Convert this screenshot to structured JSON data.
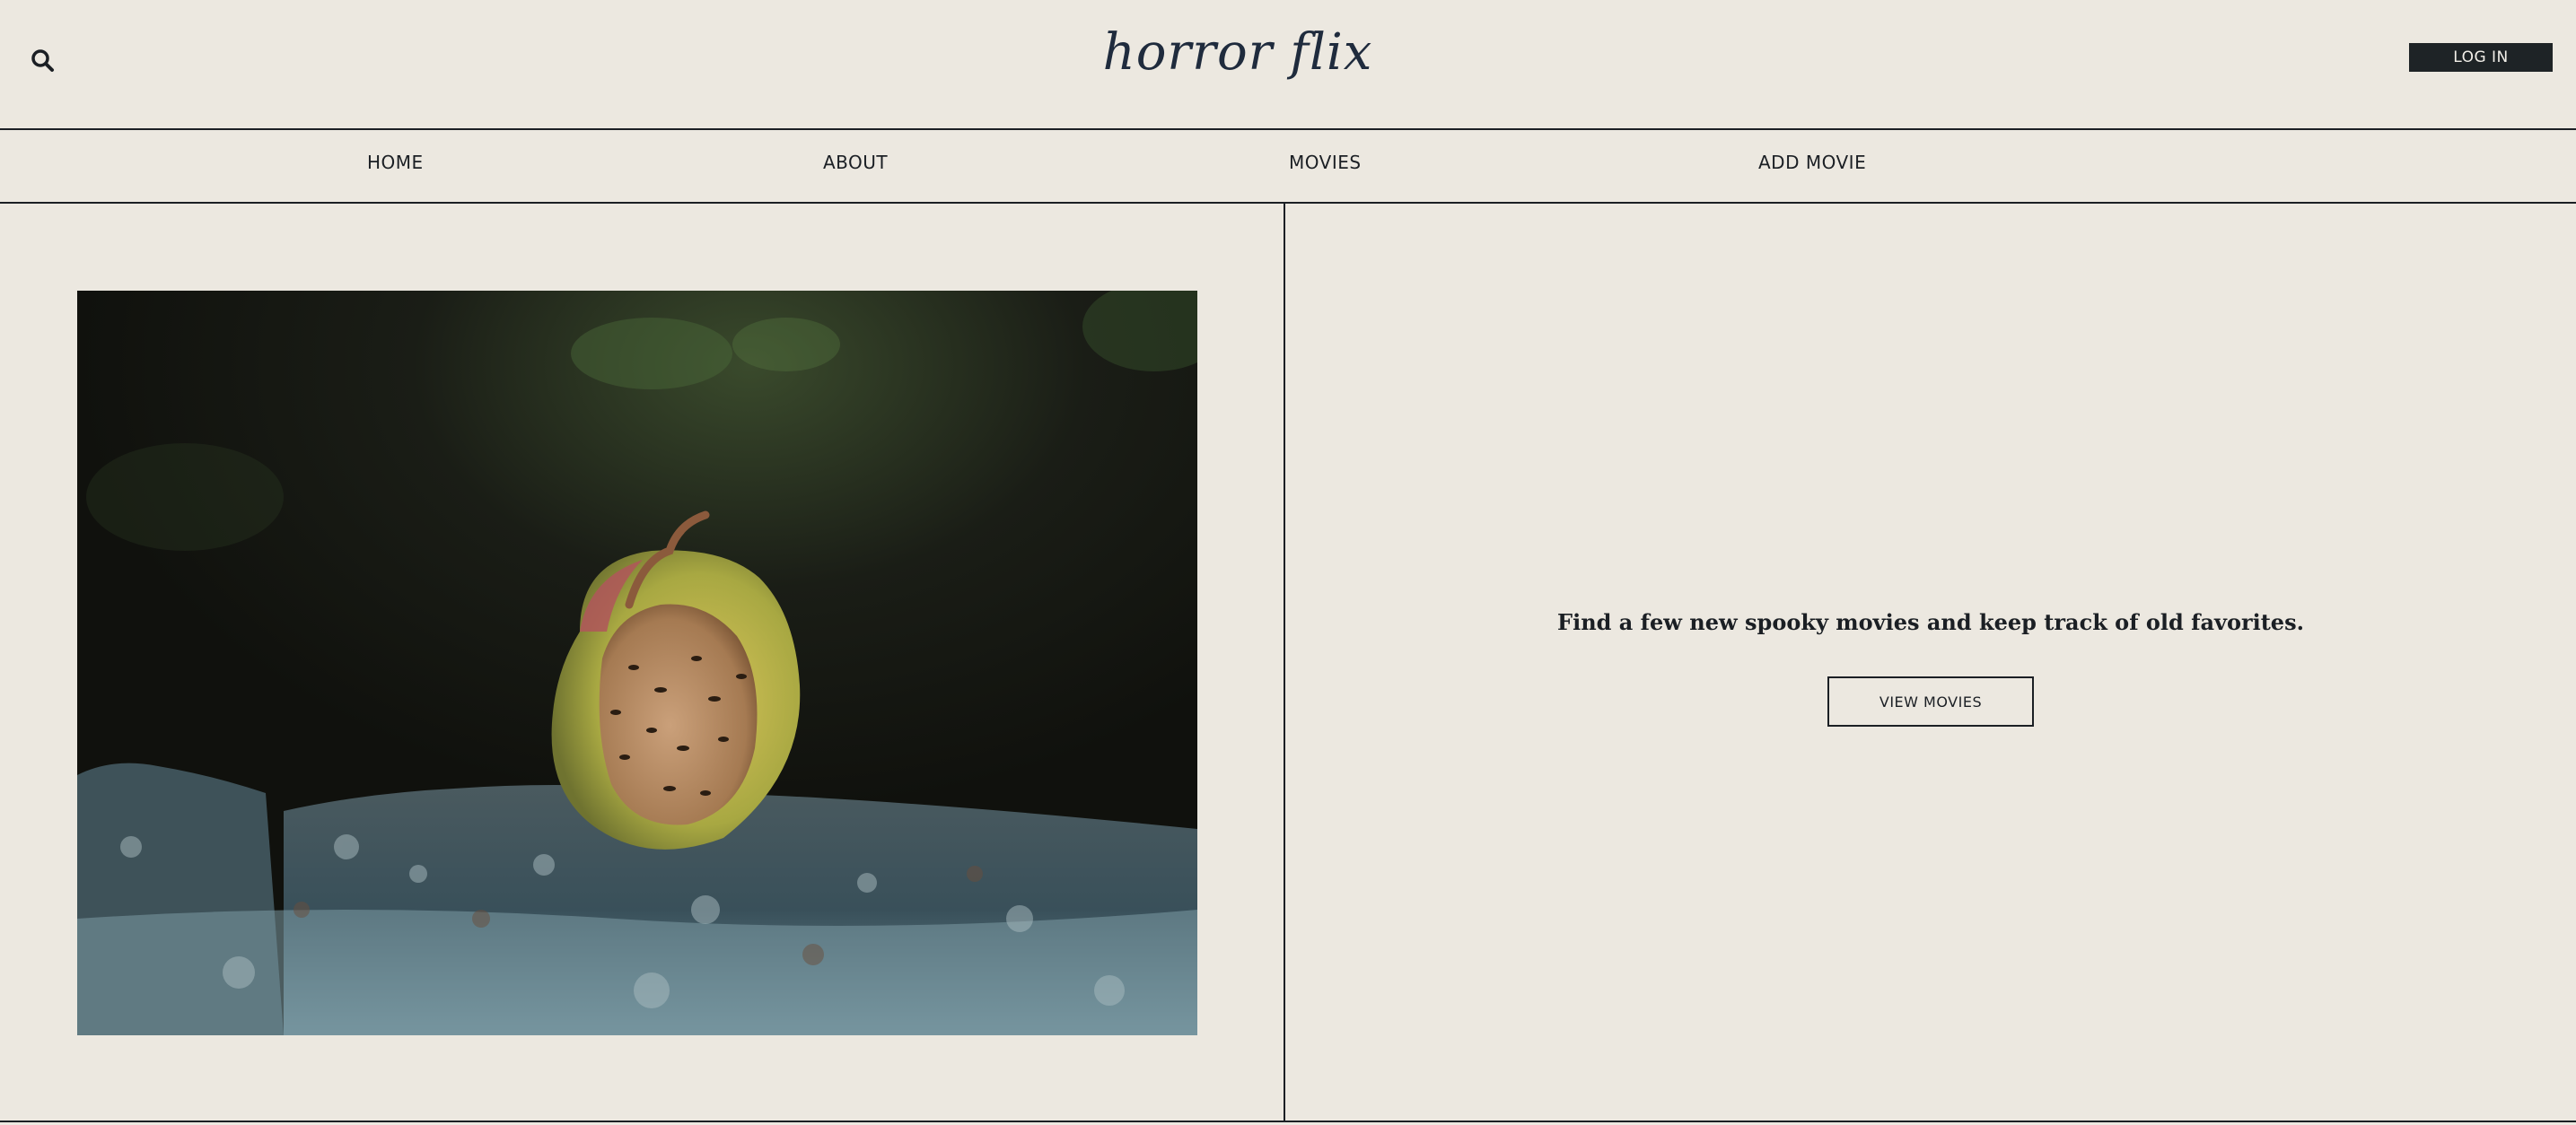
{
  "header": {
    "logo": "horror flix",
    "login_label": "LOG IN",
    "search_icon": "search-icon"
  },
  "nav": {
    "items": [
      {
        "label": "HOME"
      },
      {
        "label": "ABOUT"
      },
      {
        "label": "MOVIES"
      },
      {
        "label": "ADD MOVIE"
      }
    ]
  },
  "hero": {
    "image_subject": "rotting apple covered in ants on mossy stone",
    "tagline": "Find a few new spooky movies and keep track of old favorites.",
    "cta_label": "VIEW MOVIES"
  },
  "colors": {
    "background": "#ece8e0",
    "ink": "#1b1f24",
    "logo": "#1f2b3d",
    "login_bg": "#1e2326"
  }
}
